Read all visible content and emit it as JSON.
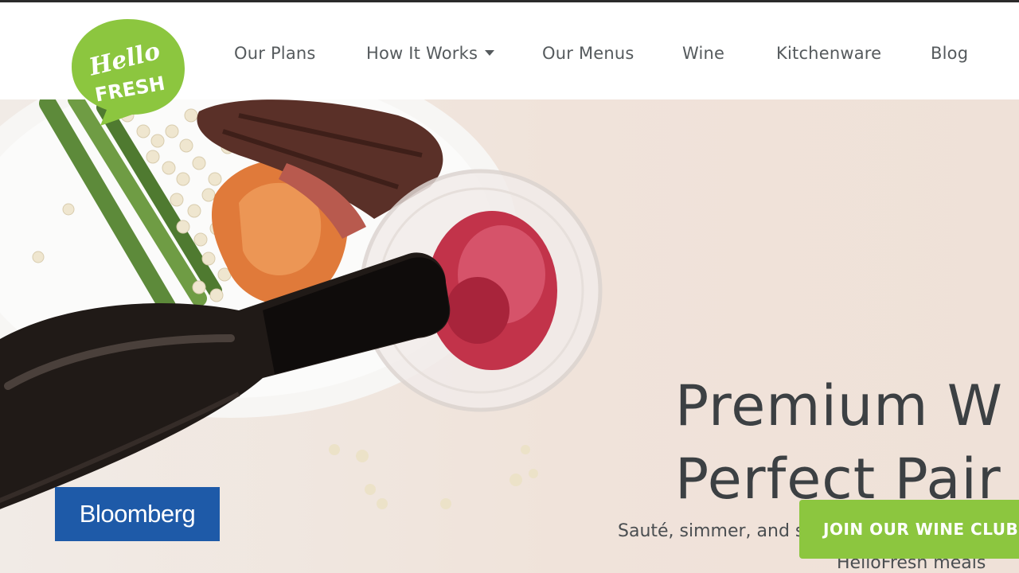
{
  "logo": {
    "line1": "Hello",
    "line2": "FRESH",
    "color": "#8cc63f"
  },
  "nav": {
    "items": [
      {
        "label": "Our Plans"
      },
      {
        "label": "How It Works"
      },
      {
        "label": "Our Menus"
      },
      {
        "label": "Wine"
      },
      {
        "label": "Kitchenware"
      },
      {
        "label": "Blog"
      }
    ]
  },
  "hero": {
    "headline_line1": "Premium W",
    "headline_line2": "Perfect Pair",
    "subtext_line1": "Sauté, simmer, and sip with wines hand-sele",
    "subtext_line2": "HelloFresh meals",
    "cta_label": "JOIN OUR WINE CLUB",
    "cta_color": "#8cc63f"
  },
  "overlay": {
    "bloomberg_label": "Bloomberg",
    "bloomberg_color": "#1e5aa8"
  }
}
